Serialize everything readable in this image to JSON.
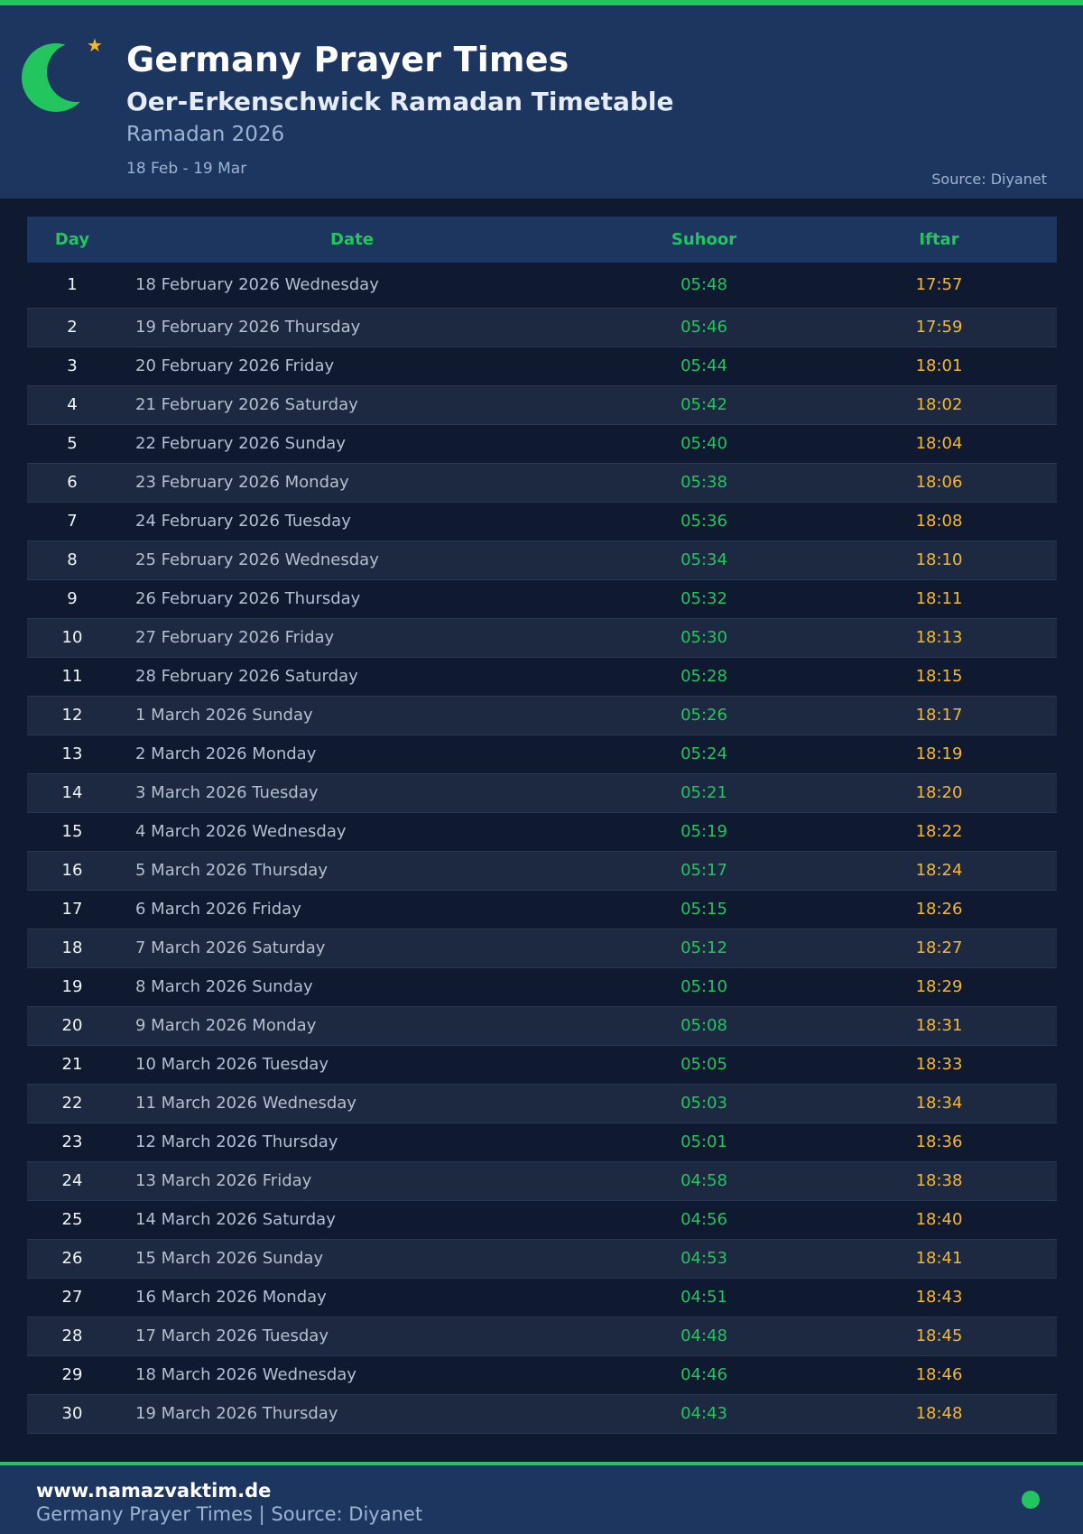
{
  "header": {
    "title": "Germany Prayer Times",
    "subtitle": "Oer-Erkenschwick Ramadan Timetable",
    "season": "Ramadan 2026",
    "range": "18 Feb - 19 Mar",
    "source": "Source: Diyanet",
    "icons": [
      "crescent-moon-icon",
      "star-icon"
    ]
  },
  "colors": {
    "accent_green": "#22c55e",
    "accent_gold": "#f5b733",
    "header_bg": "#1c3660",
    "page_bg": "#0f1930"
  },
  "table": {
    "headers": {
      "day": "Day",
      "date": "Date",
      "suhoor": "Suhoor",
      "iftar": "Iftar"
    },
    "rows": [
      {
        "day": "1",
        "date": "18 February 2026 Wednesday",
        "suhoor": "05:48",
        "iftar": "17:57"
      },
      {
        "day": "2",
        "date": "19 February 2026 Thursday",
        "suhoor": "05:46",
        "iftar": "17:59"
      },
      {
        "day": "3",
        "date": "20 February 2026 Friday",
        "suhoor": "05:44",
        "iftar": "18:01"
      },
      {
        "day": "4",
        "date": "21 February 2026 Saturday",
        "suhoor": "05:42",
        "iftar": "18:02"
      },
      {
        "day": "5",
        "date": "22 February 2026 Sunday",
        "suhoor": "05:40",
        "iftar": "18:04"
      },
      {
        "day": "6",
        "date": "23 February 2026 Monday",
        "suhoor": "05:38",
        "iftar": "18:06"
      },
      {
        "day": "7",
        "date": "24 February 2026 Tuesday",
        "suhoor": "05:36",
        "iftar": "18:08"
      },
      {
        "day": "8",
        "date": "25 February 2026 Wednesday",
        "suhoor": "05:34",
        "iftar": "18:10"
      },
      {
        "day": "9",
        "date": "26 February 2026 Thursday",
        "suhoor": "05:32",
        "iftar": "18:11"
      },
      {
        "day": "10",
        "date": "27 February 2026 Friday",
        "suhoor": "05:30",
        "iftar": "18:13"
      },
      {
        "day": "11",
        "date": "28 February 2026 Saturday",
        "suhoor": "05:28",
        "iftar": "18:15"
      },
      {
        "day": "12",
        "date": "1 March 2026 Sunday",
        "suhoor": "05:26",
        "iftar": "18:17"
      },
      {
        "day": "13",
        "date": "2 March 2026 Monday",
        "suhoor": "05:24",
        "iftar": "18:19"
      },
      {
        "day": "14",
        "date": "3 March 2026 Tuesday",
        "suhoor": "05:21",
        "iftar": "18:20"
      },
      {
        "day": "15",
        "date": "4 March 2026 Wednesday",
        "suhoor": "05:19",
        "iftar": "18:22"
      },
      {
        "day": "16",
        "date": "5 March 2026 Thursday",
        "suhoor": "05:17",
        "iftar": "18:24"
      },
      {
        "day": "17",
        "date": "6 March 2026 Friday",
        "suhoor": "05:15",
        "iftar": "18:26"
      },
      {
        "day": "18",
        "date": "7 March 2026 Saturday",
        "suhoor": "05:12",
        "iftar": "18:27"
      },
      {
        "day": "19",
        "date": "8 March 2026 Sunday",
        "suhoor": "05:10",
        "iftar": "18:29"
      },
      {
        "day": "20",
        "date": "9 March 2026 Monday",
        "suhoor": "05:08",
        "iftar": "18:31"
      },
      {
        "day": "21",
        "date": "10 March 2026 Tuesday",
        "suhoor": "05:05",
        "iftar": "18:33"
      },
      {
        "day": "22",
        "date": "11 March 2026 Wednesday",
        "suhoor": "05:03",
        "iftar": "18:34"
      },
      {
        "day": "23",
        "date": "12 March 2026 Thursday",
        "suhoor": "05:01",
        "iftar": "18:36"
      },
      {
        "day": "24",
        "date": "13 March 2026 Friday",
        "suhoor": "04:58",
        "iftar": "18:38"
      },
      {
        "day": "25",
        "date": "14 March 2026 Saturday",
        "suhoor": "04:56",
        "iftar": "18:40"
      },
      {
        "day": "26",
        "date": "15 March 2026 Sunday",
        "suhoor": "04:53",
        "iftar": "18:41"
      },
      {
        "day": "27",
        "date": "16 March 2026 Monday",
        "suhoor": "04:51",
        "iftar": "18:43"
      },
      {
        "day": "28",
        "date": "17 March 2026 Tuesday",
        "suhoor": "04:48",
        "iftar": "18:45"
      },
      {
        "day": "29",
        "date": "18 March 2026 Wednesday",
        "suhoor": "04:46",
        "iftar": "18:46"
      },
      {
        "day": "30",
        "date": "19 March 2026 Thursday",
        "suhoor": "04:43",
        "iftar": "18:48"
      }
    ]
  },
  "footer": {
    "site": "www.namazvaktim.de",
    "line": "Germany Prayer Times | Source: Diyanet",
    "icon": "status-dot-icon"
  }
}
